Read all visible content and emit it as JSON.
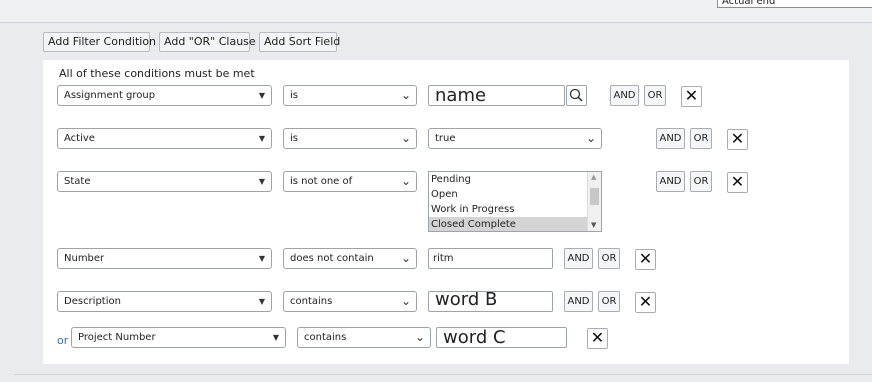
{
  "top_field": {
    "value": "Actual end"
  },
  "toolbar": {
    "add_filter_label": "Add Filter Condition",
    "add_or_label": "Add \"OR\" Clause",
    "add_sort_label": "Add Sort Field"
  },
  "conditions_title": "All of these conditions must be met",
  "conditions": [
    {
      "field": "Assignment group",
      "operator": "is",
      "value": "name",
      "and": "AND",
      "or": "OR"
    },
    {
      "field": "Active",
      "operator": "is",
      "value": "true",
      "and": "AND",
      "or": "OR"
    },
    {
      "field": "State",
      "operator": "is not one of",
      "options": [
        "Pending",
        "Open",
        "Work in Progress",
        "Closed Complete"
      ],
      "selected_option": "Closed Complete",
      "and": "AND",
      "or": "OR"
    },
    {
      "field": "Number",
      "operator": "does not contain",
      "value": "ritm",
      "and": "AND",
      "or": "OR"
    },
    {
      "field": "Description",
      "operator": "contains",
      "value": "word B",
      "and": "AND",
      "or": "OR"
    }
  ],
  "or_clause": {
    "label": "or",
    "field": "Project Number",
    "operator": "contains",
    "value": "word C"
  },
  "icons": {
    "remove": "close-icon",
    "lookup": "search-icon",
    "dropdown": "chevron-down-icon"
  }
}
